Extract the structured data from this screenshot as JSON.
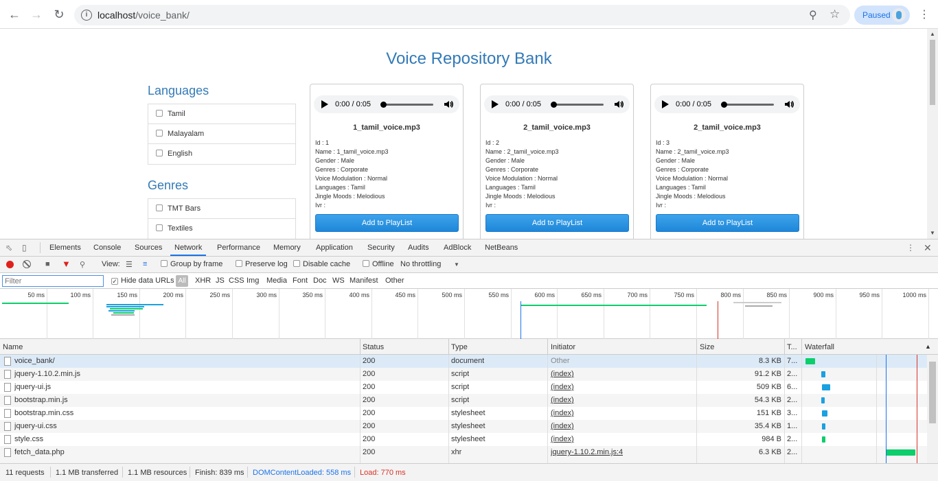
{
  "browser": {
    "url_host": "localhost",
    "url_path": "/voice_bank/",
    "profile_label": "Paused"
  },
  "page": {
    "title": "Voice Repository Bank",
    "languages_title": "Languages",
    "languages": [
      "Tamil",
      "Malayalam",
      "English"
    ],
    "genres_title": "Genres",
    "genres": [
      "TMT Bars",
      "Textiles"
    ],
    "cards": [
      {
        "time": "0:00 / 0:05",
        "progress": 0,
        "file": "1_tamil_voice.mp3",
        "meta": [
          "Id : 1",
          "Name : 1_tamil_voice.mp3",
          "Gender : Male",
          "Genres : Corporate",
          "Voice Modulation : Normal",
          "Languages : Tamil",
          "Jingle Moods : Melodious",
          "Ivr :"
        ],
        "button": "Add to PlayList"
      },
      {
        "time": "0:00 / 0:05",
        "progress": 0,
        "file": "2_tamil_voice.mp3",
        "meta": [
          "Id : 2",
          "Name : 2_tamil_voice.mp3",
          "Gender : Male",
          "Genres : Corporate",
          "Voice Modulation : Normal",
          "Languages : Tamil",
          "Jingle Moods : Melodious",
          "Ivr :"
        ],
        "button": "Add to PlayList"
      },
      {
        "time": "0:00 / 0:05",
        "progress": 0,
        "file": "2_tamil_voice.mp3",
        "meta": [
          "Id : 3",
          "Name : 2_tamil_voice.mp3",
          "Gender : Male",
          "Genres : Corporate",
          "Voice Modulation : Normal",
          "Languages : Tamil",
          "Jingle Moods : Melodious",
          "Ivr :"
        ],
        "button": "Add to PlayList"
      }
    ]
  },
  "devtools": {
    "tabs": [
      "Elements",
      "Console",
      "Sources",
      "Network",
      "Performance",
      "Memory",
      "Application",
      "Security",
      "Audits",
      "AdBlock",
      "NetBeans"
    ],
    "active_tab": "Network",
    "toolbar": {
      "view_label": "View:",
      "group_by_frame": "Group by frame",
      "preserve_log": "Preserve log",
      "disable_cache": "Disable cache",
      "offline": "Offline",
      "throttling": "No throttling"
    },
    "filter": {
      "placeholder": "Filter",
      "hide_data_urls": "Hide data URLs",
      "types": [
        "All",
        "XHR",
        "JS",
        "CSS",
        "Img",
        "Media",
        "Font",
        "Doc",
        "WS",
        "Manifest",
        "Other"
      ]
    },
    "timeline_ticks": [
      "50 ms",
      "100 ms",
      "150 ms",
      "200 ms",
      "250 ms",
      "300 ms",
      "350 ms",
      "400 ms",
      "450 ms",
      "500 ms",
      "550 ms",
      "600 ms",
      "650 ms",
      "700 ms",
      "750 ms",
      "800 ms",
      "850 ms",
      "900 ms",
      "950 ms",
      "1000 ms"
    ],
    "columns": [
      "Name",
      "Status",
      "Type",
      "Initiator",
      "Size",
      "T...",
      "Waterfall"
    ],
    "requests": [
      {
        "name": "voice_bank/",
        "status": "200",
        "type": "document",
        "initiator": "Other",
        "size": "8.3 KB",
        "time": "7..."
      },
      {
        "name": "jquery-1.10.2.min.js",
        "status": "200",
        "type": "script",
        "initiator": "(index)",
        "size": "91.2 KB",
        "time": "2..."
      },
      {
        "name": "jquery-ui.js",
        "status": "200",
        "type": "script",
        "initiator": "(index)",
        "size": "509 KB",
        "time": "6..."
      },
      {
        "name": "bootstrap.min.js",
        "status": "200",
        "type": "script",
        "initiator": "(index)",
        "size": "54.3 KB",
        "time": "2..."
      },
      {
        "name": "bootstrap.min.css",
        "status": "200",
        "type": "stylesheet",
        "initiator": "(index)",
        "size": "151 KB",
        "time": "3..."
      },
      {
        "name": "jquery-ui.css",
        "status": "200",
        "type": "stylesheet",
        "initiator": "(index)",
        "size": "35.4 KB",
        "time": "1..."
      },
      {
        "name": "style.css",
        "status": "200",
        "type": "stylesheet",
        "initiator": "(index)",
        "size": "984 B",
        "time": "2..."
      },
      {
        "name": "fetch_data.php",
        "status": "200",
        "type": "xhr",
        "initiator": "jquery-1.10.2.min.js:4",
        "size": "6.3 KB",
        "time": "2..."
      }
    ],
    "status": {
      "requests": "11 requests",
      "transferred": "1.1 MB transferred",
      "resources": "1.1 MB resources",
      "finish": "Finish: 839 ms",
      "dom_content_loaded": "DOMContentLoaded: 558 ms",
      "load": "Load: 770 ms"
    },
    "colors": {
      "dcl": "#1a73e8",
      "load": "#d93025",
      "doc": "#0cce6b",
      "script": "#1aa1e0"
    }
  }
}
